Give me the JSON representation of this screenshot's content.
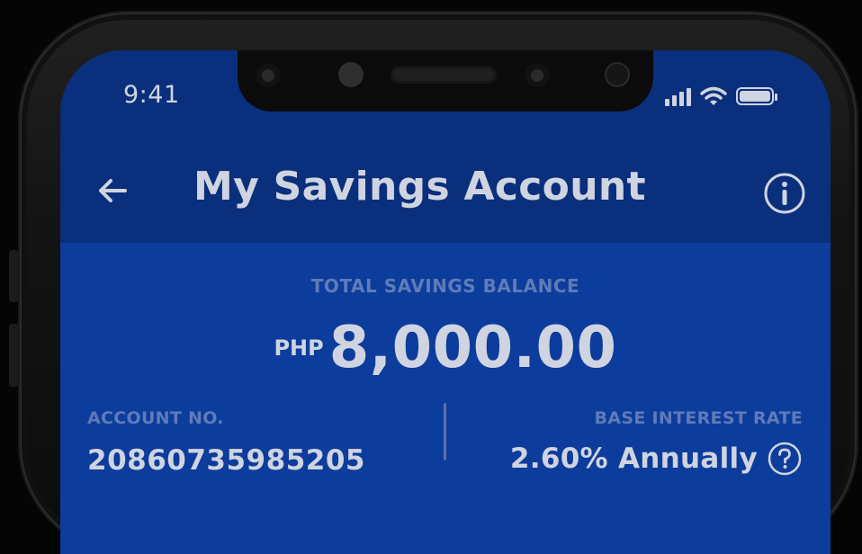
{
  "status_bar": {
    "time": "9:41",
    "icons": [
      "signal-icon",
      "wifi-icon",
      "battery-icon"
    ]
  },
  "header": {
    "back_icon": "back-arrow-icon",
    "title": "My Savings Account",
    "info_icon": "info-icon"
  },
  "balance": {
    "label": "TOTAL SAVINGS BALANCE",
    "currency": "PHP",
    "amount": "8,000.00"
  },
  "account": {
    "label": "ACCOUNT NO.",
    "number": "20860735985205"
  },
  "interest": {
    "label": "BASE INTEREST RATE",
    "value": "2.60% Annually",
    "help_icon": "question-circle-icon"
  },
  "colors": {
    "header_bg": "#0a2f7c",
    "screen_bg": "#0c3c9c",
    "text_primary": "#cfd4e0",
    "text_muted": "#5f7bb9"
  }
}
